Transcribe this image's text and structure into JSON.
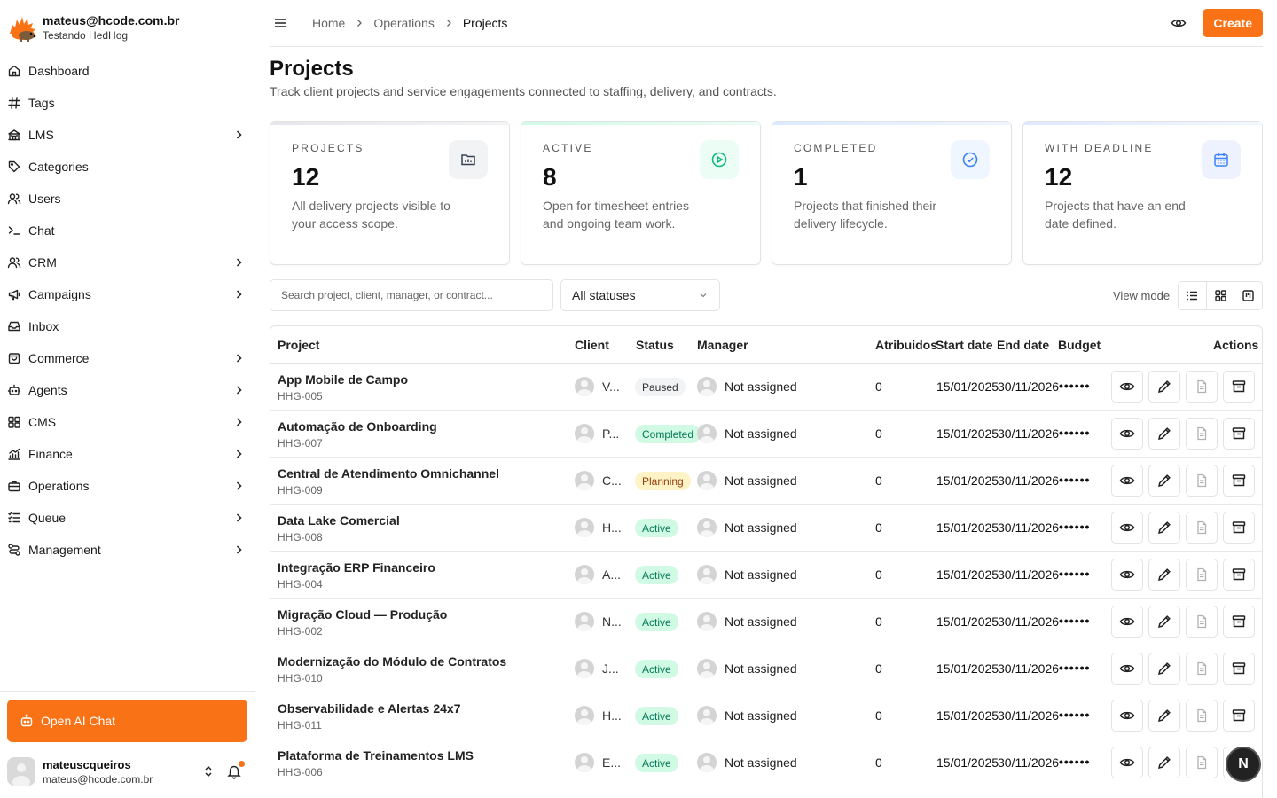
{
  "brand": {
    "email": "mateus@hcode.com.br",
    "subtitle": "Testando HedHog"
  },
  "nav": [
    {
      "label": "Dashboard",
      "icon": "home-icon",
      "chevron": false
    },
    {
      "label": "Tags",
      "icon": "hash-icon",
      "chevron": false
    },
    {
      "label": "LMS",
      "icon": "school-icon",
      "chevron": true
    },
    {
      "label": "Categories",
      "icon": "tag-icon",
      "chevron": false
    },
    {
      "label": "Users",
      "icon": "users-icon",
      "chevron": false
    },
    {
      "label": "Chat",
      "icon": "terminal-icon",
      "chevron": false
    },
    {
      "label": "CRM",
      "icon": "users-icon",
      "chevron": true
    },
    {
      "label": "Campaigns",
      "icon": "megaphone-icon",
      "chevron": true
    },
    {
      "label": "Inbox",
      "icon": "inbox-icon",
      "chevron": false
    },
    {
      "label": "Commerce",
      "icon": "shopping-bag-icon",
      "chevron": true
    },
    {
      "label": "Agents",
      "icon": "bot-icon",
      "chevron": true
    },
    {
      "label": "CMS",
      "icon": "layout-icon",
      "chevron": true
    },
    {
      "label": "Finance",
      "icon": "chart-icon",
      "chevron": true
    },
    {
      "label": "Operations",
      "icon": "briefcase-icon",
      "chevron": true
    },
    {
      "label": "Queue",
      "icon": "list-icon",
      "chevron": true
    },
    {
      "label": "Management",
      "icon": "route-icon",
      "chevron": true
    }
  ],
  "sidebar_footer": {
    "ai_button": "Open AI Chat",
    "user_name": "mateuscqueiros",
    "user_email": "mateus@hcode.com.br"
  },
  "topbar": {
    "breadcrumb": [
      "Home",
      "Operations",
      "Projects"
    ],
    "create_label": "Create"
  },
  "page": {
    "title": "Projects",
    "subtitle": "Track client projects and service engagements connected to staffing, delivery, and contracts."
  },
  "stats": [
    {
      "label": "PROJECTS",
      "value": "12",
      "desc": "All delivery projects visible to your access scope.",
      "icon": "folder-chart-icon",
      "color": "#374151",
      "bg": "#f1f3f5"
    },
    {
      "label": "ACTIVE",
      "value": "8",
      "desc": "Open for timesheet entries and ongoing team work.",
      "icon": "play-circle-icon",
      "color": "#10b981",
      "bg": "#ecfdf5"
    },
    {
      "label": "COMPLETED",
      "value": "1",
      "desc": "Projects that finished their delivery lifecycle.",
      "icon": "check-circle-icon",
      "color": "#3b82f6",
      "bg": "#eff6ff"
    },
    {
      "label": "WITH DEADLINE",
      "value": "12",
      "desc": "Projects that have an end date defined.",
      "icon": "calendar-icon",
      "color": "#3b82f6",
      "bg": "#eef2ff"
    }
  ],
  "filters": {
    "search_placeholder": "Search project, client, manager, or contract...",
    "status_value": "All statuses",
    "view_mode_label": "View mode"
  },
  "table": {
    "headers": [
      "Project",
      "Client",
      "Status",
      "Manager",
      "Atribuidos",
      "Start date",
      "End date",
      "Budget",
      "Actions"
    ],
    "rows": [
      {
        "name": "App Mobile de Campo",
        "code": "HHG-005",
        "client": "V...",
        "status": "Paused",
        "status_class": "st-paused",
        "manager": "Not assigned",
        "assigned": "0",
        "start": "15/01/2025",
        "end": "30/11/2026",
        "budget": "••••••"
      },
      {
        "name": "Automação de Onboarding",
        "code": "HHG-007",
        "client": "P...",
        "status": "Completed",
        "status_class": "st-completed",
        "manager": "Not assigned",
        "assigned": "0",
        "start": "15/01/2025",
        "end": "30/11/2026",
        "budget": "••••••"
      },
      {
        "name": "Central de Atendimento Omnichannel",
        "code": "HHG-009",
        "client": "C...",
        "status": "Planning",
        "status_class": "st-planning",
        "manager": "Not assigned",
        "assigned": "0",
        "start": "15/01/2025",
        "end": "30/11/2026",
        "budget": "••••••"
      },
      {
        "name": "Data Lake Comercial",
        "code": "HHG-008",
        "client": "H...",
        "status": "Active",
        "status_class": "st-active",
        "manager": "Not assigned",
        "assigned": "0",
        "start": "15/01/2025",
        "end": "30/11/2026",
        "budget": "••••••"
      },
      {
        "name": "Integração ERP Financeiro",
        "code": "HHG-004",
        "client": "A...",
        "status": "Active",
        "status_class": "st-active",
        "manager": "Not assigned",
        "assigned": "0",
        "start": "15/01/2025",
        "end": "30/11/2026",
        "budget": "••••••"
      },
      {
        "name": "Migração Cloud — Produção",
        "code": "HHG-002",
        "client": "N...",
        "status": "Active",
        "status_class": "st-active",
        "manager": "Not assigned",
        "assigned": "0",
        "start": "15/01/2025",
        "end": "30/11/2026",
        "budget": "••••••"
      },
      {
        "name": "Modernização do Módulo de Contratos",
        "code": "HHG-010",
        "client": "J...",
        "status": "Active",
        "status_class": "st-active",
        "manager": "Not assigned",
        "assigned": "0",
        "start": "15/01/2025",
        "end": "30/11/2026",
        "budget": "••••••"
      },
      {
        "name": "Observabilidade e Alertas 24x7",
        "code": "HHG-011",
        "client": "H...",
        "status": "Active",
        "status_class": "st-active",
        "manager": "Not assigned",
        "assigned": "0",
        "start": "15/01/2025",
        "end": "30/11/2026",
        "budget": "••••••"
      },
      {
        "name": "Plataforma de Treinamentos LMS",
        "code": "HHG-006",
        "client": "E...",
        "status": "Active",
        "status_class": "st-active",
        "manager": "Not assigned",
        "assigned": "0",
        "start": "15/01/2025",
        "end": "30/11/2026",
        "budget": "••••••"
      }
    ]
  },
  "fab_letter": "N",
  "accent_color": "#f97316"
}
